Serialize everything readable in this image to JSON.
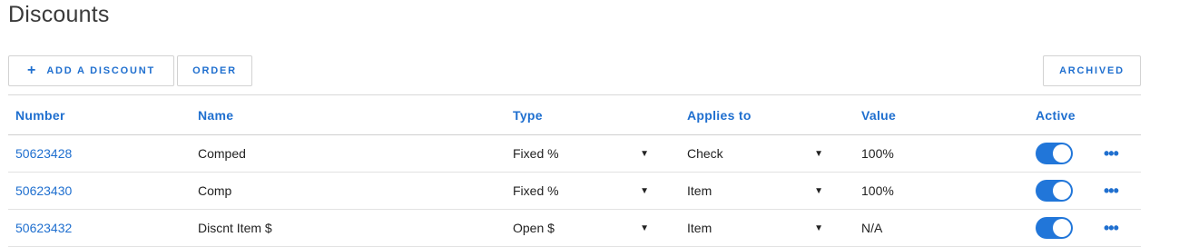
{
  "page": {
    "title": "Discounts"
  },
  "toolbar": {
    "add_icon": "+",
    "add_label": "ADD A DISCOUNT",
    "order_label": "ORDER",
    "archived_label": "ARCHIVED"
  },
  "table": {
    "headers": {
      "number": "Number",
      "name": "Name",
      "type": "Type",
      "applies_to": "Applies to",
      "value": "Value",
      "active": "Active"
    },
    "rows": [
      {
        "number": "50623428",
        "name": "Comped",
        "type": "Fixed %",
        "applies_to": "Check",
        "value": "100%",
        "active": true
      },
      {
        "number": "50623430",
        "name": "Comp",
        "type": "Fixed %",
        "applies_to": "Item",
        "value": "100%",
        "active": true
      },
      {
        "number": "50623432",
        "name": "Discnt Item $",
        "type": "Open $",
        "applies_to": "Item",
        "value": "N/A",
        "active": true
      }
    ]
  },
  "icons": {
    "caret": "▼",
    "more": "•••"
  },
  "colors": {
    "accent": "#1f6fcf",
    "toggle_on": "#2176d9"
  }
}
